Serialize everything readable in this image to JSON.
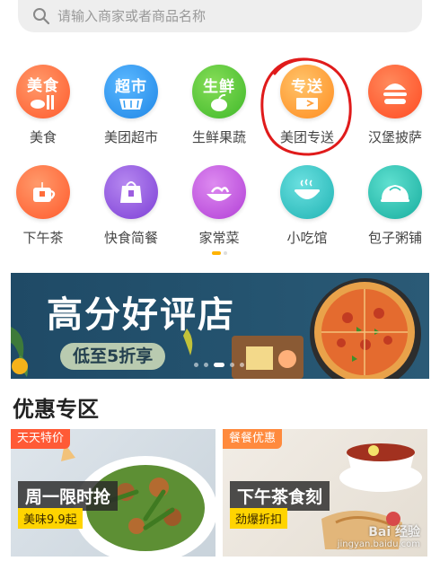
{
  "search": {
    "placeholder": "请输入商家或者商品名称"
  },
  "categories": [
    {
      "icon_text": "美食",
      "label": "美食",
      "color": "#ff7043",
      "icon": "fork-knife-icon"
    },
    {
      "icon_text": "超市",
      "label": "美团超市",
      "color": "#2b9af3",
      "icon": "basket-icon"
    },
    {
      "icon_text": "生鲜",
      "label": "生鲜果蔬",
      "color": "#52c234",
      "icon": "apple-icon"
    },
    {
      "icon_text": "专送",
      "label": "美团专送",
      "color": "#ff9f3a",
      "icon": "delivery-box-icon"
    },
    {
      "icon_text": "",
      "label": "汉堡披萨",
      "color": "#ff5a36",
      "icon": "burger-icon"
    },
    {
      "icon_text": "",
      "label": "下午茶",
      "color": "#ff6d3b",
      "icon": "tea-cup-icon"
    },
    {
      "icon_text": "",
      "label": "快食简餐",
      "color": "#9c5de0",
      "icon": "takeout-bag-icon"
    },
    {
      "icon_text": "",
      "label": "家常菜",
      "color": "#c65de0",
      "icon": "dish-icon"
    },
    {
      "icon_text": "",
      "label": "小吃馆",
      "color": "#33c9c9",
      "icon": "bowl-icon"
    },
    {
      "icon_text": "",
      "label": "包子粥铺",
      "color": "#2ec7b8",
      "icon": "bun-icon"
    }
  ],
  "pager": {
    "active_color": "#ffb300",
    "inactive_color": "#dddddd"
  },
  "banner": {
    "headline": "高分好评店",
    "pill": "低至5折享"
  },
  "section": {
    "title": "优惠专区"
  },
  "promos": [
    {
      "tag": "天天特价",
      "title": "周一限时抢",
      "sub": "美味9.9起",
      "tag_color": "#ff5a36",
      "sub_color": "#ffd400"
    },
    {
      "tag": "餐餐优惠",
      "title": "下午茶食刻",
      "sub": "劲爆折扣",
      "tag_color": "#ff8a3d",
      "sub_color": "#ffd400"
    }
  ],
  "watermark": {
    "brand": "Bai 经验",
    "url": "jingyan.baidu.com"
  },
  "annotation": {
    "color": "#e01b1b"
  }
}
